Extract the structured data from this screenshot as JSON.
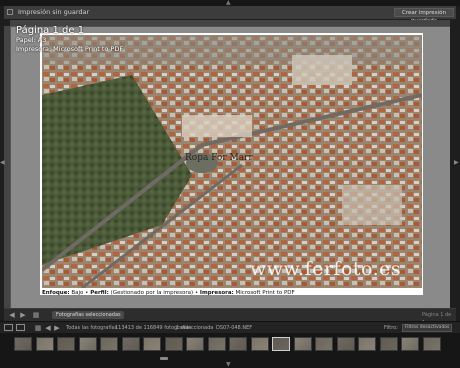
{
  "header": {
    "title": "Impresión sin guardar",
    "save_button": "Crear impresión guardada"
  },
  "page_info": {
    "page_label": "Página 1 de 1",
    "paper_label": "Papel: A3",
    "printer_label": "Impresora: Microsoft Print to PDF"
  },
  "photo": {
    "watermark": "www.ferfoto.es",
    "stamp": "Ropa For Marr"
  },
  "caption": {
    "focus_label": "Enfoque:",
    "focus_value": "Bajo",
    "profile_label": "Perfil:",
    "profile_value": "(Gestionado por la impresora)",
    "printer_label": "Impresora:",
    "printer_value": "Microsoft Print to PDF"
  },
  "toolbar": {
    "selection_pill": "Fotografías seleccionadas",
    "page_counter": "Página 1 de 1"
  },
  "filmstrip_header": {
    "source_label": "Todas las fotografías",
    "count_label": "113413 de 116849 fotografías",
    "selected_label": "1 seleccionada",
    "filename": "DS07-048.NEF",
    "filter_label": "Filtro:",
    "filter_value": "Filtros desactivados"
  },
  "filmstrip": {
    "thumbnails": [
      "t1",
      "t2",
      "t3",
      "t4",
      "t5",
      "t6",
      "t7",
      "t8",
      "t9",
      "t10",
      "t11",
      "t12",
      "t13",
      "t14",
      "t15",
      "t16",
      "t17",
      "t18",
      "t19",
      "t20"
    ],
    "selected_index": 12
  },
  "colors": {
    "background": "#1e1e1e",
    "canvas": "#8a8a8a",
    "header": "#3c3c3c"
  },
  "icons": [
    "check-icon",
    "triangle-up-icon",
    "triangle-left-icon",
    "triangle-right-icon",
    "grid-view-icon",
    "loupe-view-icon",
    "back-icon",
    "forward-icon",
    "triangle-down-icon"
  ]
}
